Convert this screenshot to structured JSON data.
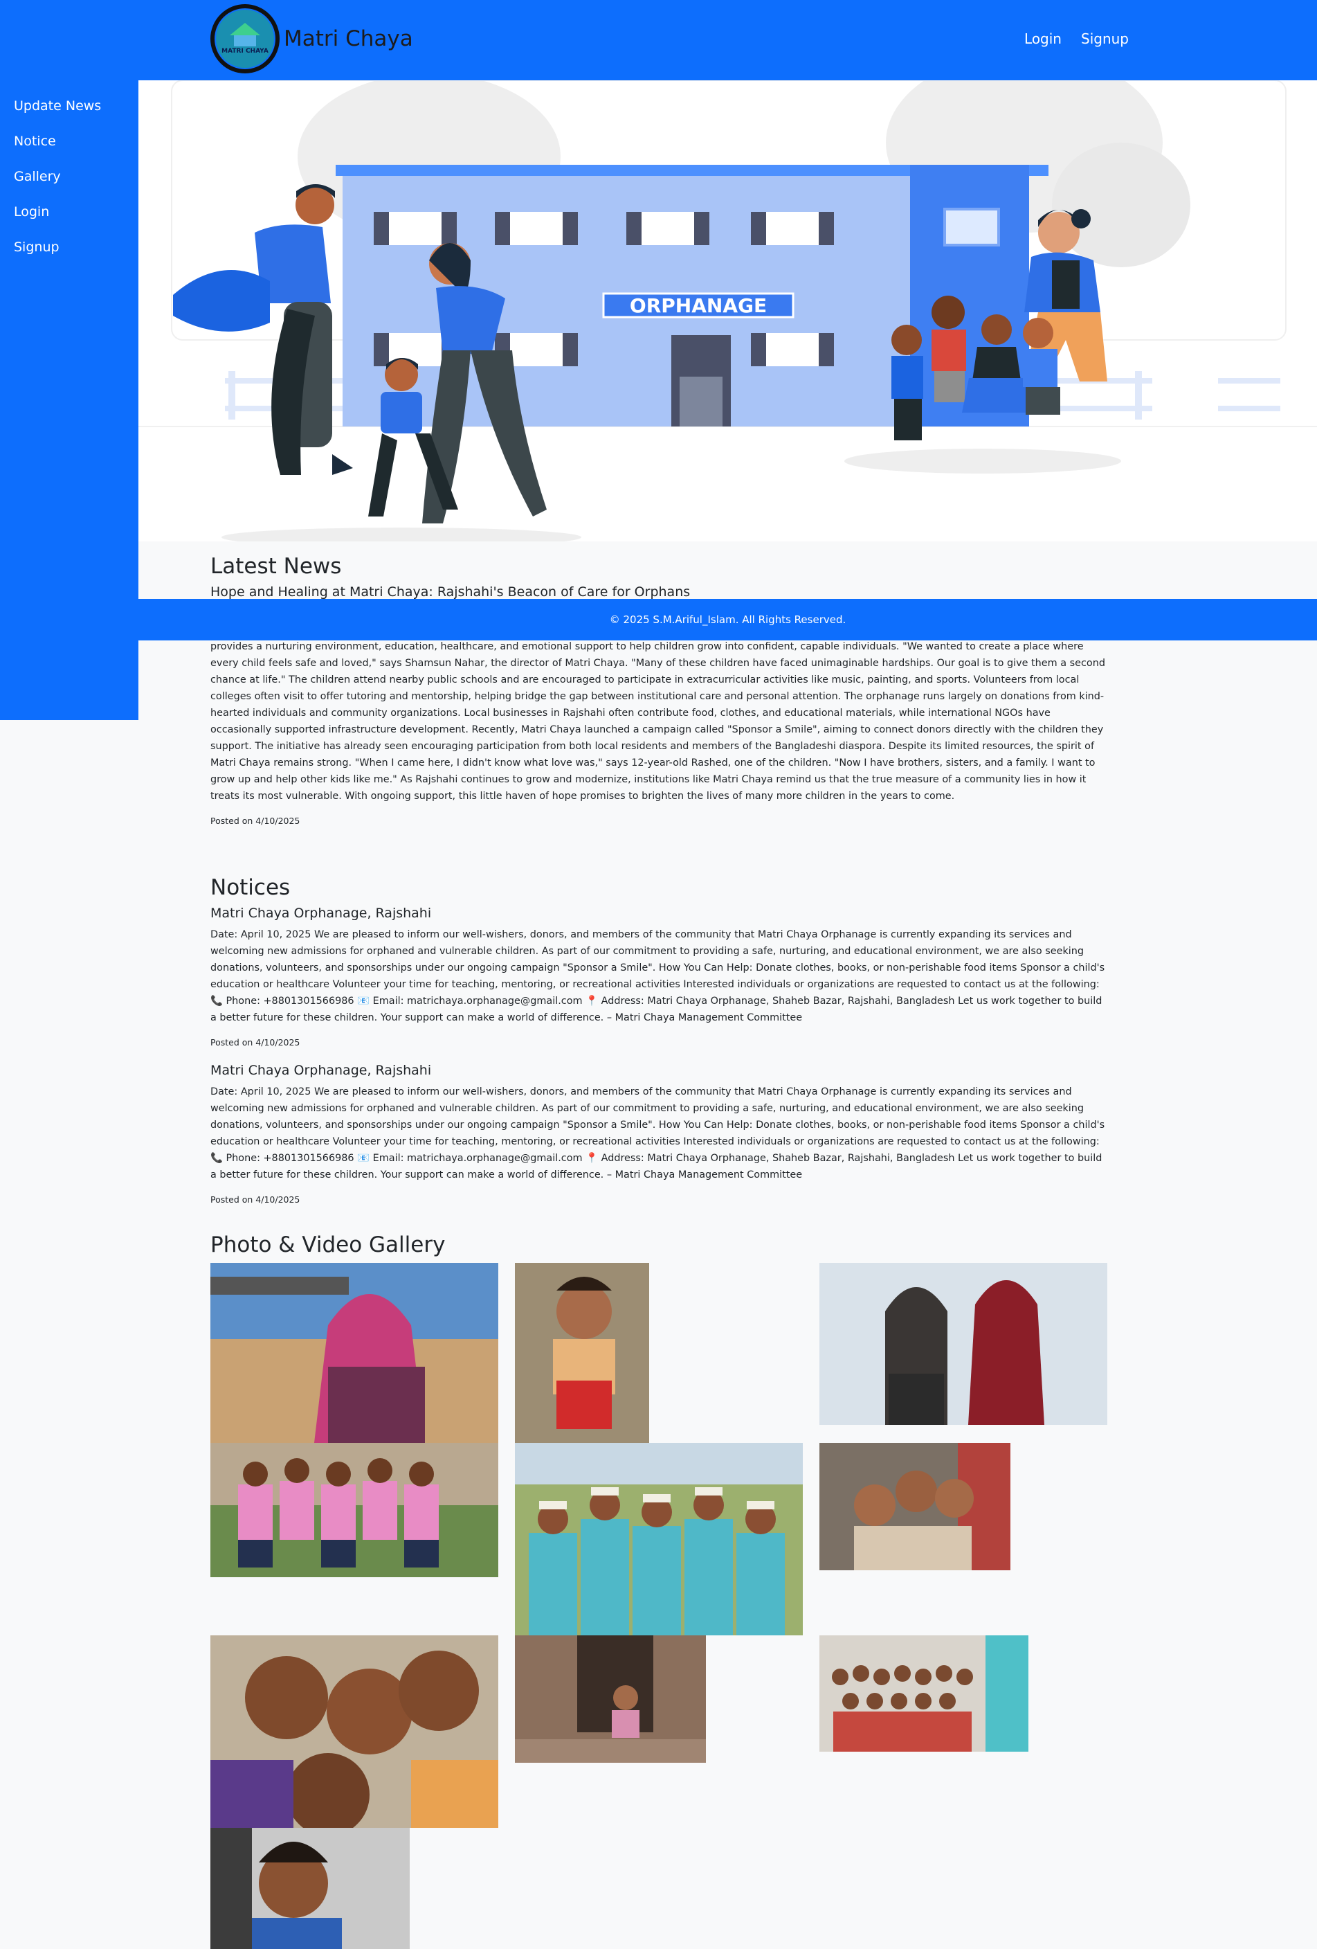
{
  "navbar": {
    "brand": "Matri Chaya",
    "logo_text": "MATRI CHAYA",
    "links": [
      "Login",
      "Signup"
    ],
    "color": "#0d6efd"
  },
  "sidebar": {
    "items": [
      {
        "label": "Update News"
      },
      {
        "label": "Notice"
      },
      {
        "label": "Gallery"
      },
      {
        "label": "Login"
      },
      {
        "label": "Signup"
      }
    ]
  },
  "hero": {
    "building_sign": "ORPHANAGE"
  },
  "footer": {
    "text": "© 2025 S.M.Ariful_Islam. All Rights Reserved."
  },
  "news": {
    "heading": "Latest News",
    "title": "Hope and Healing at Matri Chaya: Rajshahi's Beacon of Care for Orphans",
    "body": "its name meaning \"Mother's Shelter,\" Matri Chaya is more than just a home for children without parents—it's a sanctuary of love, hope, and opportunity. Founded in 2012 by a group of local social workers and philanthropists, Matri Chaya currently houses over 60 children ranging in age from 3 to 18. The orphanage offers more than just shelter—it provides a nurturing environment, education, healthcare, and emotional support to help children grow into confident, capable individuals. \"We wanted to create a place where every child feels safe and loved,\" says Shamsun Nahar, the director of Matri Chaya. \"Many of these children have faced unimaginable hardships. Our goal is to give them a second chance at life.\" The children attend nearby public schools and are encouraged to participate in extracurricular activities like music, painting, and sports. Volunteers from local colleges often visit to offer tutoring and mentorship, helping bridge the gap between institutional care and personal attention. The orphanage runs largely on donations from kind-hearted individuals and community organizations. Local businesses in Rajshahi often contribute food, clothes, and educational materials, while international NGOs have occasionally supported infrastructure development. Recently, Matri Chaya launched a campaign called \"Sponsor a Smile\", aiming to connect donors directly with the children they support. The initiative has already seen encouraging participation from both local residents and members of the Bangladeshi diaspora. Despite its limited resources, the spirit of Matri Chaya remains strong. \"When I came here, I didn't know what love was,\" says 12-year-old Rashed, one of the children. \"Now I have brothers, sisters, and a family. I want to grow up and help other kids like me.\" As Rajshahi continues to grow and modernize, institutions like Matri Chaya remind us that the true measure of a community lies in how it treats its most vulnerable. With ongoing support, this little haven of hope promises to brighten the lives of many more children in the years to come.",
    "posted": "Posted on 4/10/2025"
  },
  "notices": {
    "heading": "Notices",
    "items": [
      {
        "title": "Matri Chaya Orphanage, Rajshahi",
        "body": "Date: April 10, 2025 We are pleased to inform our well-wishers, donors, and members of the community that Matri Chaya Orphanage is currently expanding its services and welcoming new admissions for orphaned and vulnerable children. As part of our commitment to providing a safe, nurturing, and educational environment, we are also seeking donations, volunteers, and sponsorships under our ongoing campaign \"Sponsor a Smile\". How You Can Help: Donate clothes, books, or non-perishable food items Sponsor a child's education or healthcare Volunteer your time for teaching, mentoring, or recreational activities Interested individuals or organizations are requested to contact us at the following: 📞 Phone: +8801301566986 📧 Email: matrichaya.orphanage@gmail.com 📍 Address: Matri Chaya Orphanage, Shaheb Bazar, Rajshahi, Bangladesh Let us work together to build a better future for these children. Your support can make a world of difference. – Matri Chaya Management Committee",
        "posted": "Posted on 4/10/2025"
      },
      {
        "title": "Matri Chaya Orphanage, Rajshahi",
        "body": "Date: April 10, 2025 We are pleased to inform our well-wishers, donors, and members of the community that Matri Chaya Orphanage is currently expanding its services and welcoming new admissions for orphaned and vulnerable children. As part of our commitment to providing a safe, nurturing, and educational environment, we are also seeking donations, volunteers, and sponsorships under our ongoing campaign \"Sponsor a Smile\". How You Can Help: Donate clothes, books, or non-perishable food items Sponsor a child's education or healthcare Volunteer your time for teaching, mentoring, or recreational activities Interested individuals or organizations are requested to contact us at the following: 📞 Phone: +8801301566986 📧 Email: matrichaya.orphanage@gmail.com 📍 Address: Matri Chaya Orphanage, Shaheb Bazar, Rajshahi, Bangladesh Let us work together to build a better future for these children. Your support can make a world of difference. – Matri Chaya Management Committee",
        "posted": "Posted on 4/10/2025"
      }
    ]
  },
  "gallery": {
    "heading": "Photo & Video Gallery"
  }
}
